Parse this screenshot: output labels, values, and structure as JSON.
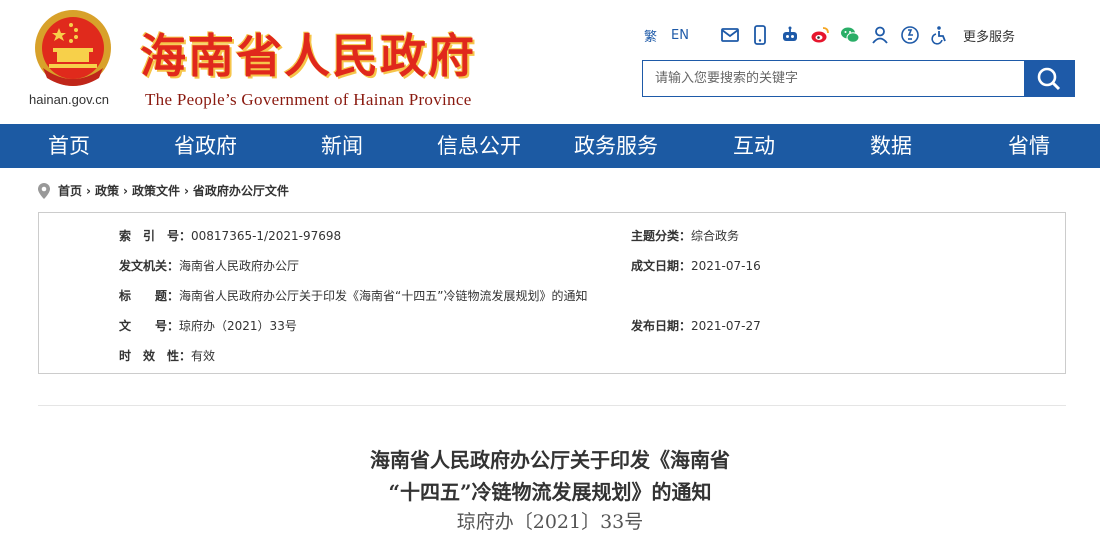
{
  "header": {
    "domain": "hainan.gov.cn",
    "title": "海南省人民政府",
    "subtitle": "The People’s Government  of Hainan Province",
    "lang_trad": "繁",
    "lang_en": "EN",
    "more_services": "更多服务",
    "icons": [
      "mail-icon",
      "mobile-icon",
      "robot-icon",
      "weibo-icon",
      "wechat-icon",
      "user-icon",
      "elderly-mode-icon",
      "accessibility-icon"
    ],
    "colors": {
      "title_red": "#e0281c",
      "accent_blue": "#1c5aa3"
    }
  },
  "search": {
    "placeholder": "请输入您要搜索的关键字"
  },
  "nav": [
    "首页",
    "省政府",
    "新闻",
    "信息公开",
    "政务服务",
    "互动",
    "数据",
    "省情"
  ],
  "breadcrumb": [
    "首页",
    "政策",
    "政策文件",
    "省政府办公厅文件"
  ],
  "info": {
    "index_label": "索　引　号：",
    "index_value": "00817365-1/2021-97698",
    "topic_label": "主题分类：",
    "topic_value": "综合政务",
    "issuer_label": "发文机关：",
    "issuer_value": "海南省人民政府办公厅",
    "created_label": "成文日期：",
    "created_value": "2021-07-16",
    "title_label": "标　　题：",
    "title_value": "海南省人民政府办公厅关于印发《海南省“十四五”冷链物流发展规划》的通知",
    "docno_label": "文　　号：",
    "docno_value": "琼府办（2021）33号",
    "published_label": "发布日期：",
    "published_value": "2021-07-27",
    "validity_label": "时　效　性：",
    "validity_value": "有效"
  },
  "document": {
    "title_line1": "海南省人民政府办公厅关于印发《海南省",
    "title_line2": "“十四五”冷链物流发展规划》的通知",
    "number": "琼府办〔2021〕33号"
  }
}
